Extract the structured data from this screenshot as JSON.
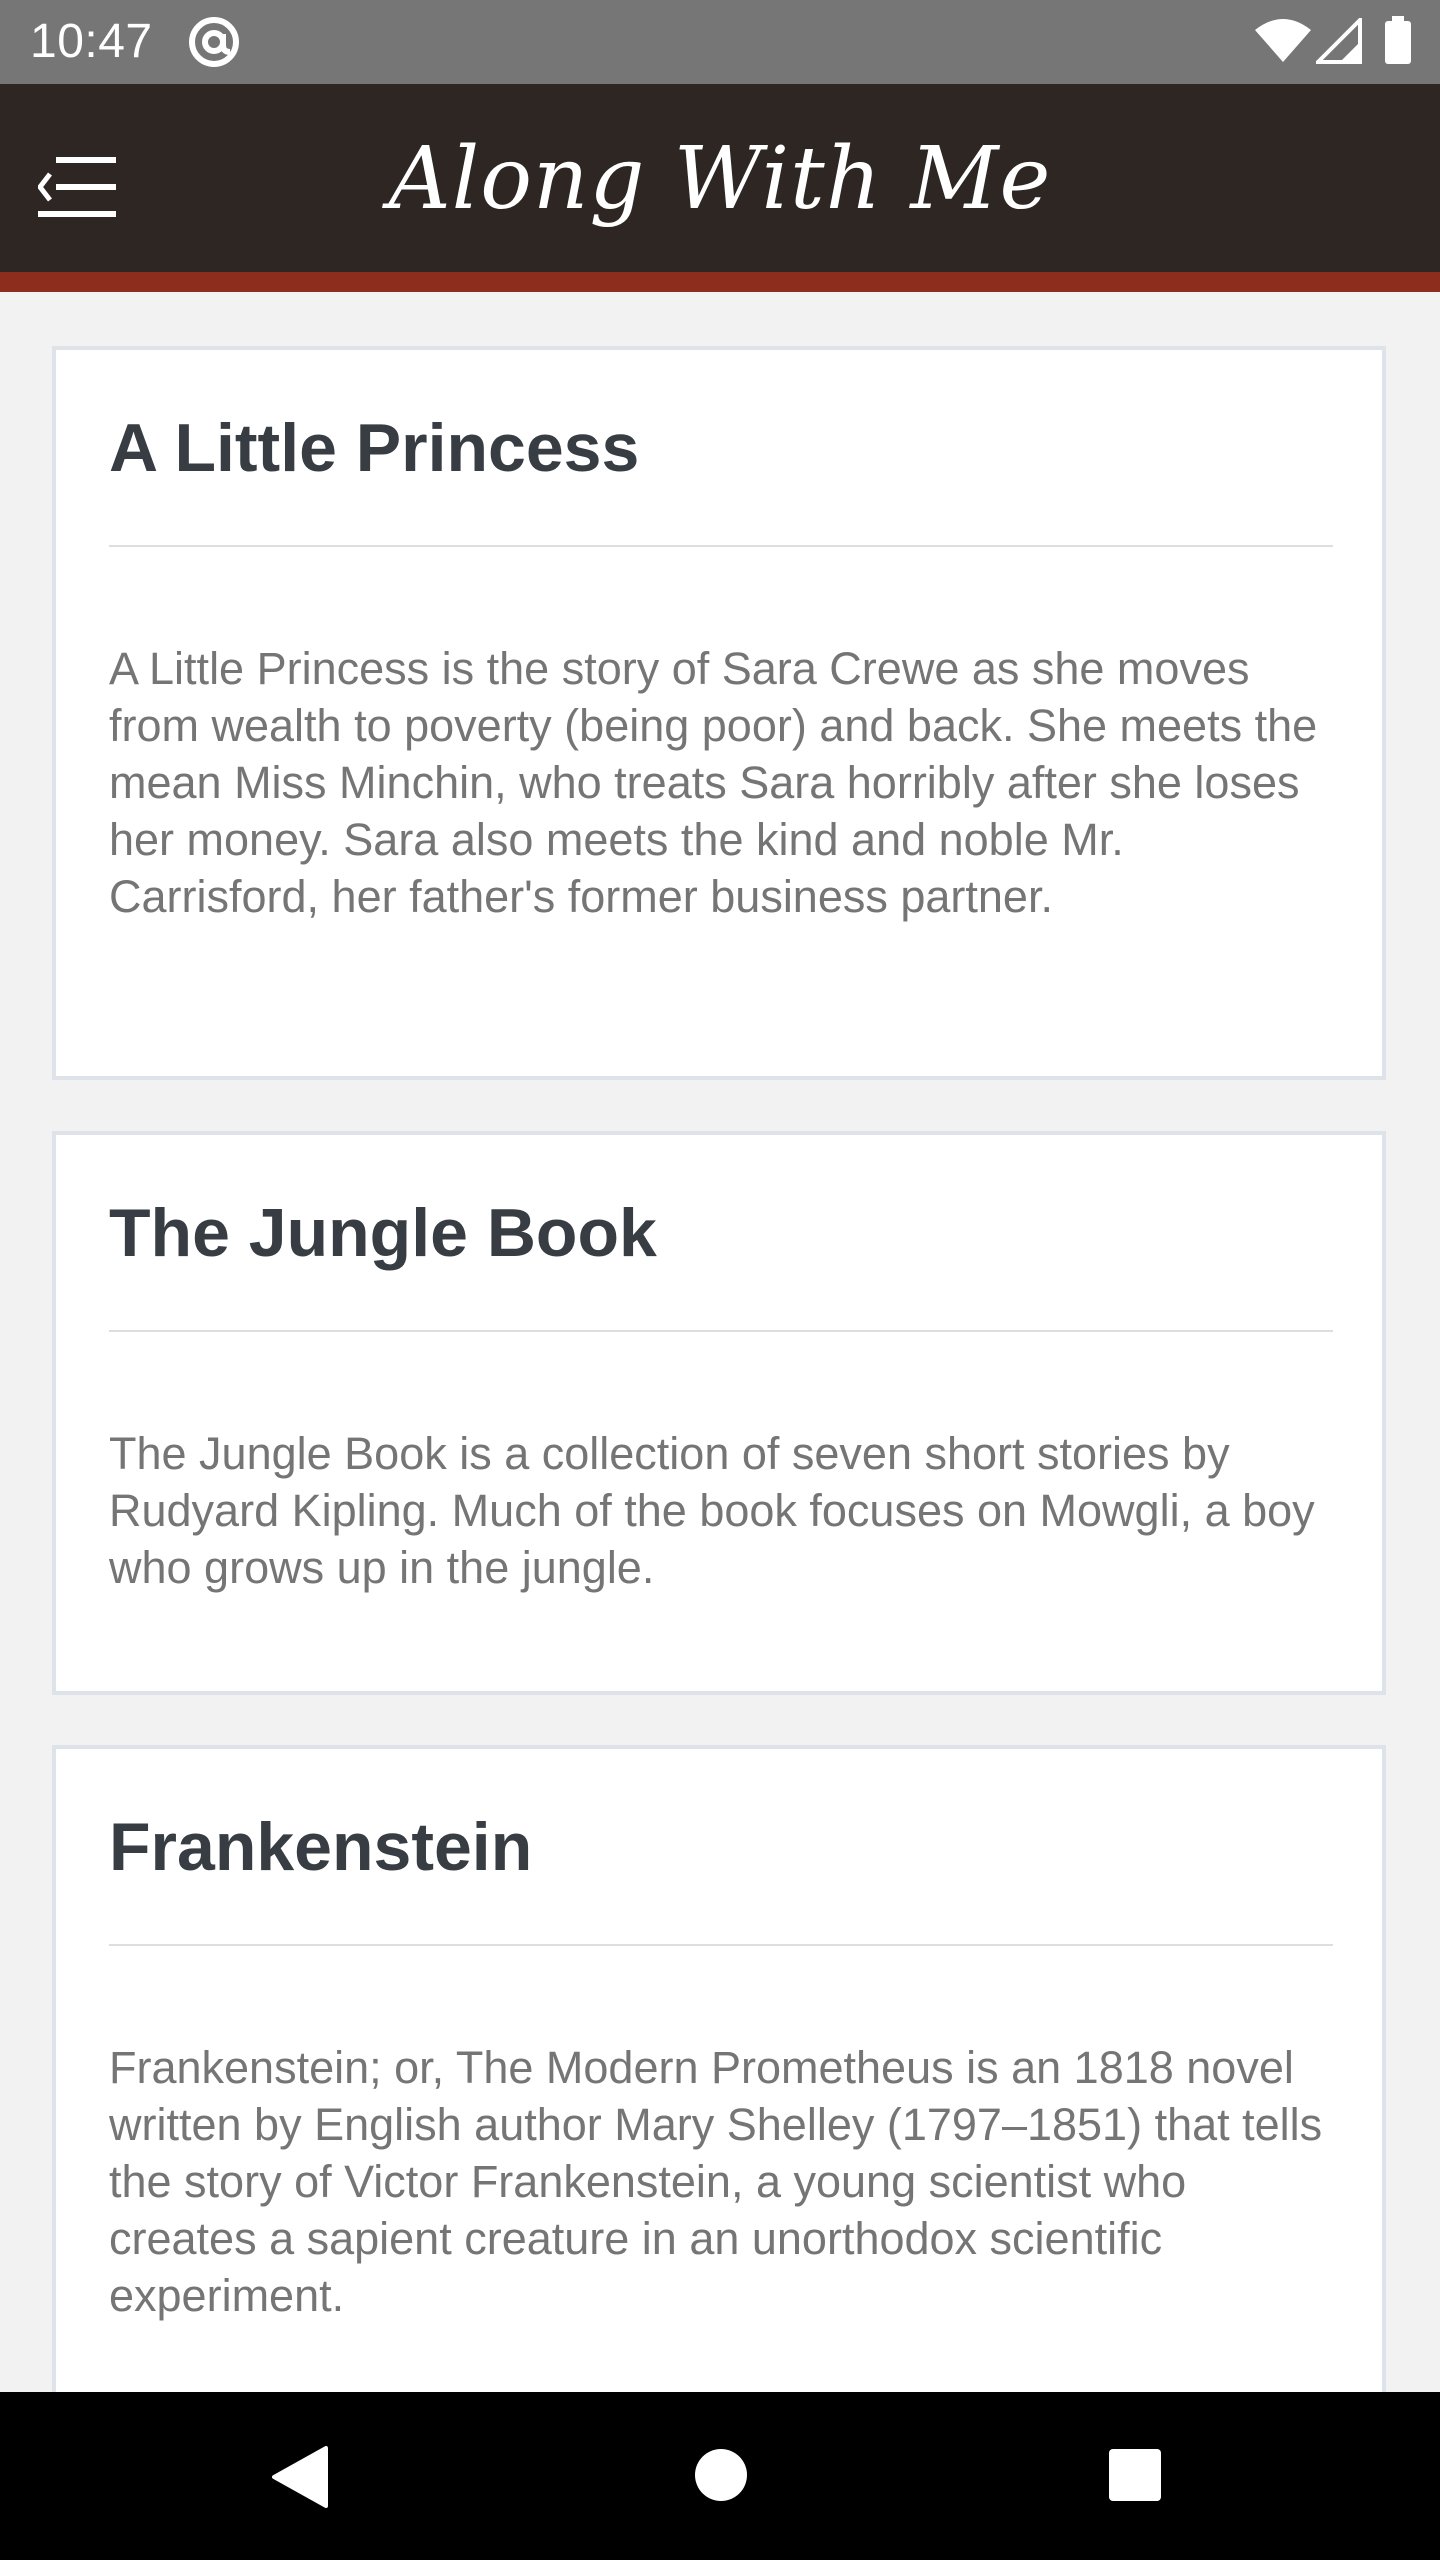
{
  "status_bar": {
    "time": "10:47",
    "icons": [
      "at-sign-icon",
      "wifi-icon",
      "signal-icon",
      "battery-icon"
    ]
  },
  "app_bar": {
    "title": "Along With Me",
    "menu_icon": "menu-back-icon",
    "background_color": "#2e2623",
    "accent_color": "#8c2d1e"
  },
  "books": [
    {
      "title": "A Little Princess",
      "description": "A Little Princess is the story of Sara Crewe as she moves from wealth to poverty (being poor) and back. She meets the mean Miss Minchin, who treats Sara horribly after she loses her money. Sara also meets the kind and noble Mr. Carrisford, her father's former business partner."
    },
    {
      "title": "The Jungle Book",
      "description": "The Jungle Book is a collection of seven short stories by Rudyard Kipling. Much of the book focuses on Mowgli, a boy who grows up in the jungle."
    },
    {
      "title": "Frankenstein",
      "description": "Frankenstein; or, The Modern Prometheus is an 1818 novel written by English author Mary Shelley (1797–1851) that tells the story of Victor Frankenstein, a young scientist who creates a sapient creature in an unorthodox scientific experiment."
    }
  ],
  "nav_bar": {
    "icons": [
      "back-triangle-icon",
      "home-circle-icon",
      "recents-square-icon"
    ]
  }
}
